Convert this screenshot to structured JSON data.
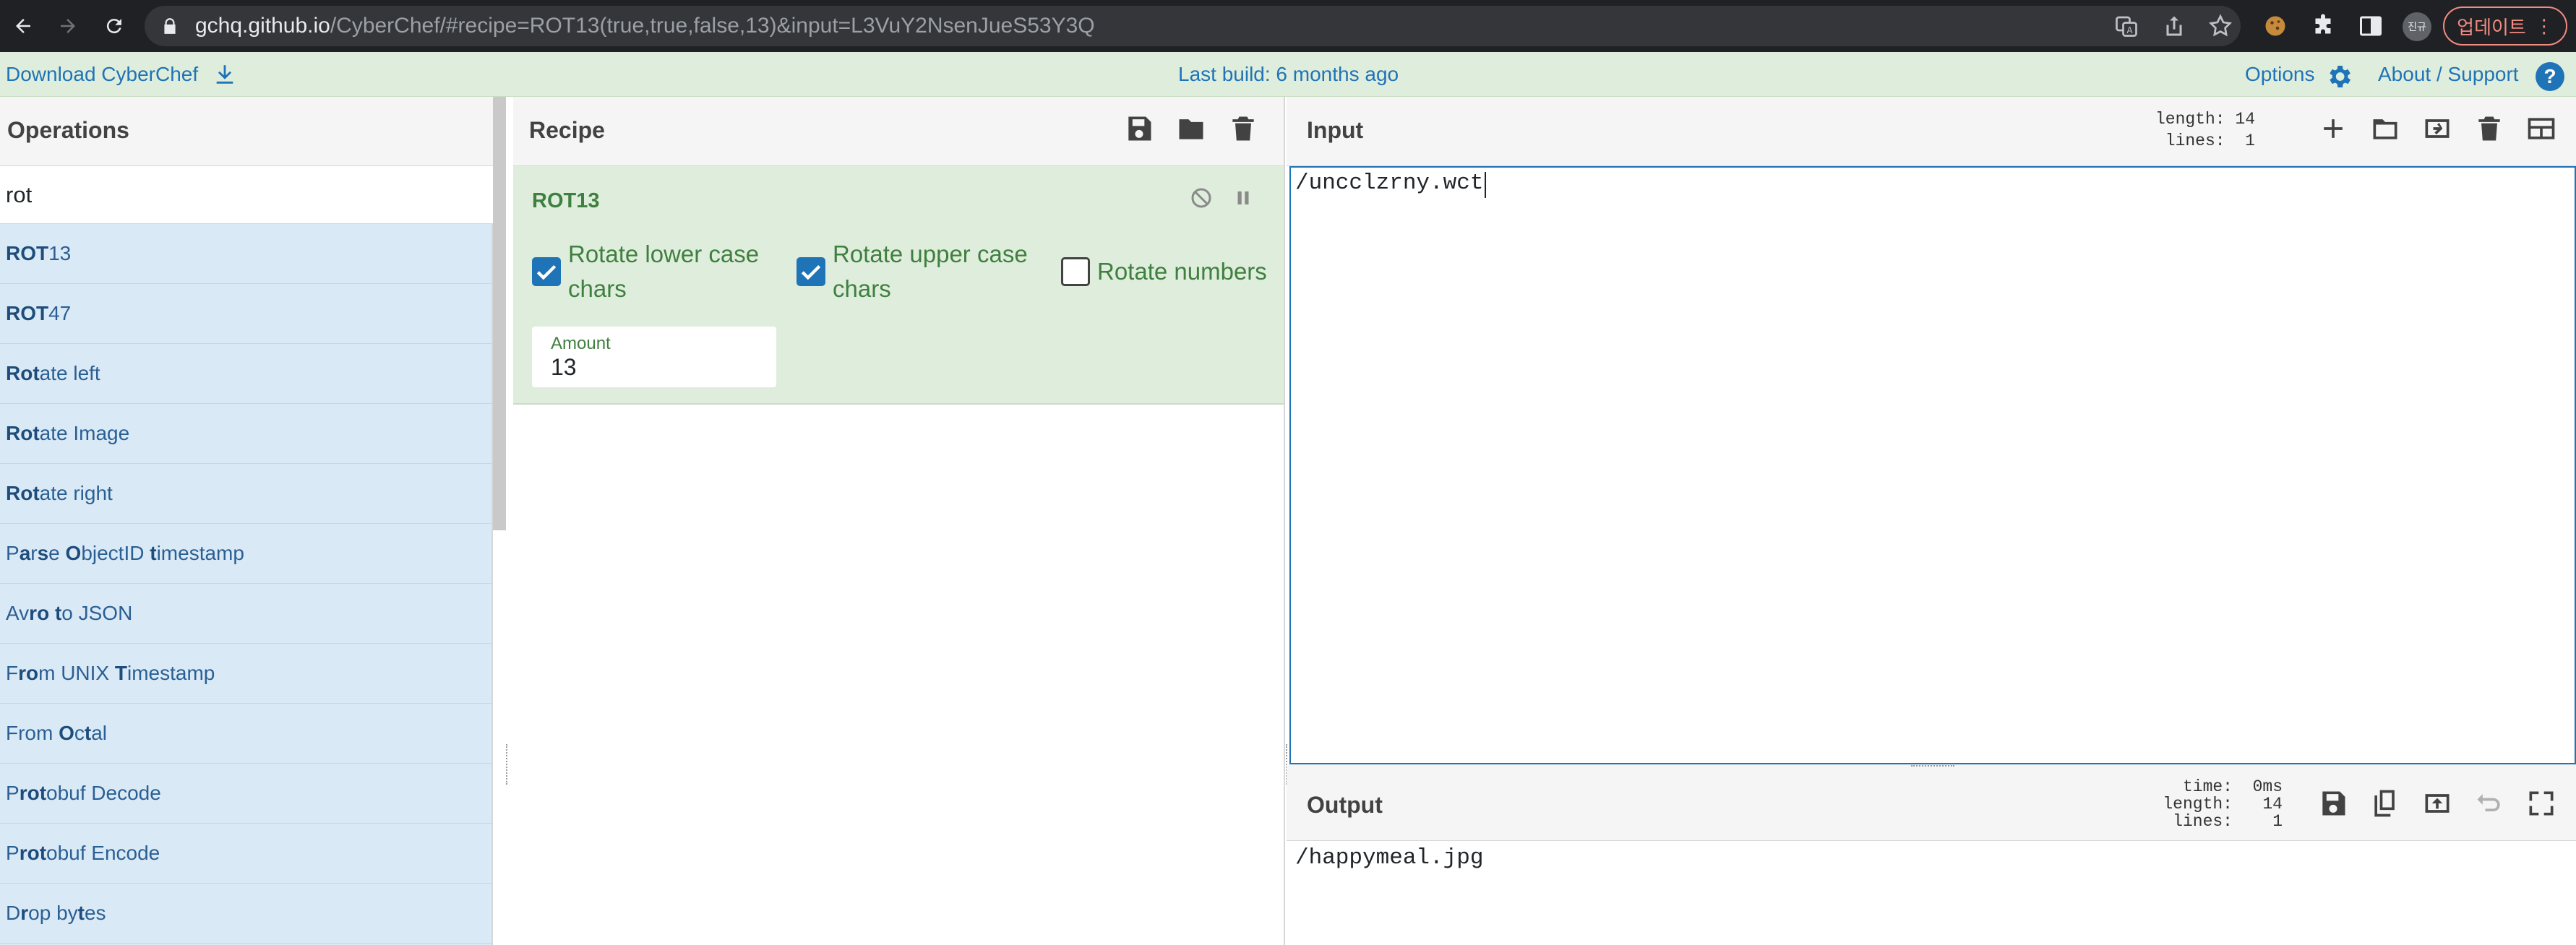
{
  "browser": {
    "url_host": "gchq.github.io",
    "url_path": "/CyberChef/#recipe=ROT13(true,true,false,13)&input=L3VuY2NsenJueS53Y3Q",
    "profile_label": "진규",
    "update_label": "업데이트"
  },
  "banner": {
    "download_label": "Download CyberChef",
    "build_label": "Last build: 6 months ago",
    "options_label": "Options",
    "about_label": "About / Support"
  },
  "operations": {
    "title": "Operations",
    "search_value": "rot",
    "items": [
      {
        "bold": "ROT",
        "rest": "13"
      },
      {
        "bold": "ROT",
        "rest": "47"
      },
      {
        "bold": "Rot",
        "rest": "ate left"
      },
      {
        "bold": "Rot",
        "rest": "ate Image"
      },
      {
        "bold": "Rot",
        "rest": "ate right"
      },
      {
        "html": "P<b>a</b>r<b>s</b>e <b>O</b>bjectID <b>t</b>imestamp"
      },
      {
        "html": "Av<b>ro</b> <b>t</b>o JSON"
      },
      {
        "html": "F<b>ro</b>m UNIX <b>T</b>imestamp"
      },
      {
        "html": "From <b>O</b>c<b>t</b>al"
      },
      {
        "html": "P<b>rot</b>obuf Decode"
      },
      {
        "html": "P<b>rot</b>obuf Encode"
      },
      {
        "html": "D<b>r</b>op by<b>t</b>es"
      }
    ]
  },
  "recipe": {
    "title": "Recipe",
    "operation_name": "ROT13",
    "options": {
      "lower_label": "Rotate lower case chars",
      "lower_checked": true,
      "upper_label": "Rotate upper case chars",
      "upper_checked": true,
      "numbers_label": "Rotate numbers",
      "numbers_checked": false
    },
    "amount_label": "Amount",
    "amount_value": "13"
  },
  "input": {
    "title": "Input",
    "length_line": "length: 14",
    "lines_line": "lines:  1",
    "text": "/uncclzrny.wct"
  },
  "output": {
    "title": "Output",
    "time_line": "time:  0ms",
    "length_line": "length:   14",
    "lines_line": "lines:    1",
    "text": "/happymeal.jpg"
  },
  "colors": {
    "accent_blue": "#1f73b7",
    "recipe_green_bg": "#dfeedc",
    "ops_blue_bg": "#dae9f6",
    "label_green": "#3f7f3f"
  }
}
